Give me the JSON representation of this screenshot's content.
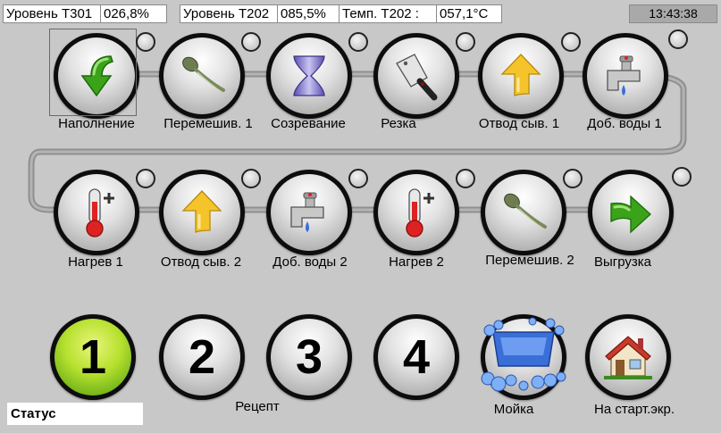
{
  "header": {
    "level_t301_label": "Уровень Т301",
    "level_t301_value": "026,8%",
    "level_t202_label": "Уровень Т202",
    "level_t202_value": "085,5%",
    "temp_t202_label": "Темп. Т202 :",
    "temp_t202_value": "057,1°C",
    "clock": "13:43:38"
  },
  "steps_row1": [
    {
      "label": "Наполнение",
      "icon": "arrow-down-green-icon"
    },
    {
      "label": "Перемешив. 1",
      "icon": "spoon-icon"
    },
    {
      "label": "Созревание",
      "icon": "hourglass-icon"
    },
    {
      "label": "Резка",
      "icon": "cleaver-icon"
    },
    {
      "label": "Отвод сыв. 1",
      "icon": "arrow-up-yellow-icon"
    },
    {
      "label": "Доб. воды 1",
      "icon": "faucet-icon"
    }
  ],
  "steps_row2": [
    {
      "label": "Нагрев 1",
      "icon": "thermometer-plus-icon"
    },
    {
      "label": "Отвод сыв. 2",
      "icon": "arrow-up-yellow-icon"
    },
    {
      "label": "Доб. воды 2",
      "icon": "faucet-icon"
    },
    {
      "label": "Нагрев 2",
      "icon": "thermometer-plus-icon"
    },
    {
      "label": "Перемешив. 2",
      "icon": "spoon-icon"
    },
    {
      "label": "Выгрузка",
      "icon": "arrow-right-green-icon"
    }
  ],
  "recipes": {
    "buttons": [
      "1",
      "2",
      "3",
      "4"
    ],
    "label": "Рецепт",
    "active_color": "#8cc820"
  },
  "wash": {
    "label": "Мойка",
    "icon": "wash-bubbles-icon"
  },
  "home": {
    "label": "На старт.экр.",
    "icon": "house-icon"
  },
  "status": {
    "label": "Статус"
  },
  "colors": {
    "background": "#c8c8c8",
    "pipe": "#9a9a9a"
  }
}
